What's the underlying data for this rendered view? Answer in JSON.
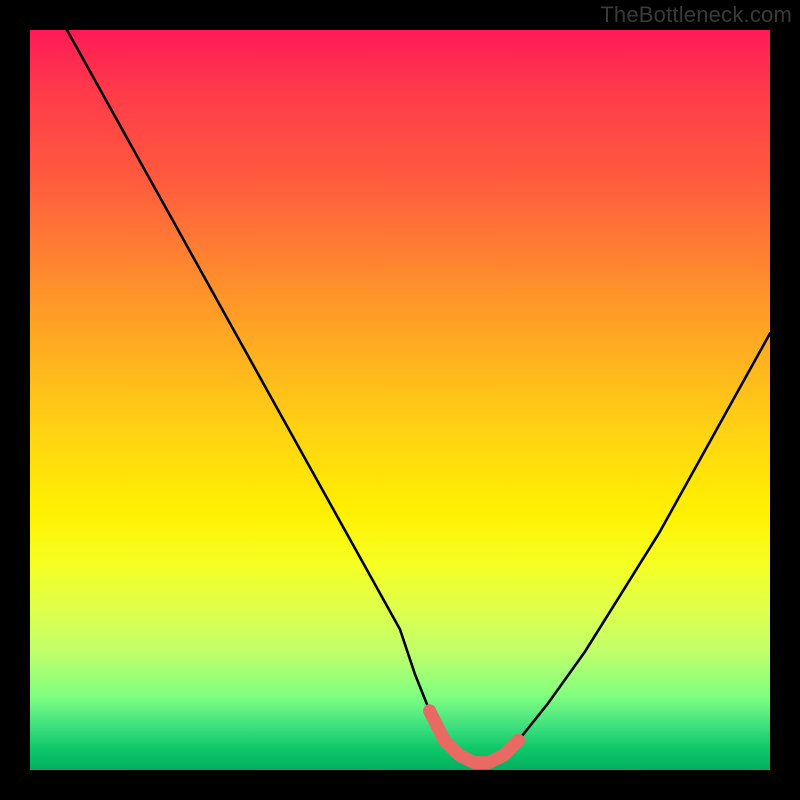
{
  "watermark": "TheBottleneck.com",
  "chart_data": {
    "type": "line",
    "title": "",
    "xlabel": "",
    "ylabel": "",
    "xlim": [
      0,
      100
    ],
    "ylim": [
      0,
      100
    ],
    "series": [
      {
        "name": "bottleneck-curve",
        "x": [
          5,
          10,
          15,
          20,
          25,
          30,
          35,
          40,
          45,
          50,
          52,
          54,
          56,
          58,
          60,
          62,
          64,
          66,
          70,
          75,
          80,
          85,
          90,
          95,
          100
        ],
        "values": [
          100,
          91,
          82,
          73,
          64,
          55,
          46,
          37,
          28,
          19,
          13,
          8,
          4,
          2,
          1,
          1,
          2,
          4,
          9,
          16,
          24,
          32,
          41,
          50,
          59
        ]
      }
    ],
    "highlight_segment": {
      "name": "trough-highlight",
      "x": [
        54,
        56,
        58,
        60,
        62,
        64,
        66
      ],
      "values": [
        8,
        4,
        2,
        1,
        1,
        2,
        4
      ],
      "color": "#e96a63"
    },
    "background_gradient": {
      "top_color": "#ff1a57",
      "mid_color": "#fff000",
      "bottom_color": "#00b060"
    }
  }
}
